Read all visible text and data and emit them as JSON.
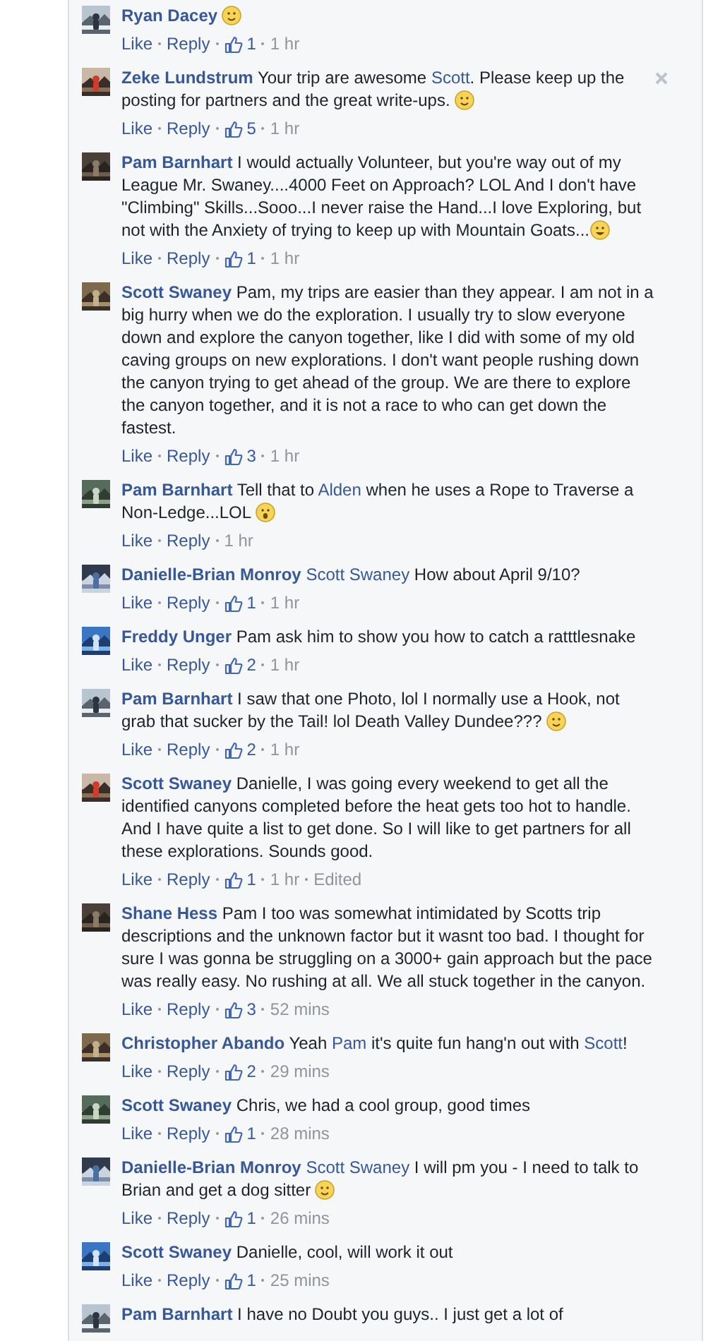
{
  "comments": [
    {
      "author": "Ryan Dacey",
      "body": [
        {
          "kind": "smile"
        }
      ],
      "actions": [
        "Like",
        "Reply"
      ],
      "likes": "1",
      "time": "1 hr",
      "show_close": false
    },
    {
      "author": "Zeke Lundstrum",
      "body": [
        {
          "kind": "text",
          "text": "Your trip are awesome "
        },
        {
          "kind": "mention",
          "text": "Scott"
        },
        {
          "kind": "text",
          "text": ". Please keep up the posting for partners and the great write-ups. "
        },
        {
          "kind": "smile"
        }
      ],
      "actions": [
        "Like",
        "Reply"
      ],
      "likes": "5",
      "time": "1 hr",
      "show_close": true
    },
    {
      "author": "Pam Barnhart",
      "body": [
        {
          "kind": "text",
          "text": "I would actually Volunteer, but you're way out of my League Mr. Swaney....4000 Feet on Approach? LOL And I don't have \"Climbing\" Skills...Sooo...I never raise the Hand...I love Exploring, but not with the Anxiety of trying to keep up with Mountain Goats..."
        },
        {
          "kind": "grin"
        }
      ],
      "actions": [
        "Like",
        "Reply"
      ],
      "likes": "1",
      "time": "1 hr",
      "show_close": false
    },
    {
      "author": "Scott Swaney",
      "body": [
        {
          "kind": "text",
          "text": "Pam, my trips are easier than they appear. I am not in a big hurry when we do the exploration. I usually try to slow everyone down and explore the canyon together, like I did with some of my old caving groups on new explorations. I don't want people rushing down the canyon trying to get ahead of the group. We are there to explore the canyon together, and it is not a race to who can get down the fastest."
        }
      ],
      "actions": [
        "Like",
        "Reply"
      ],
      "likes": "3",
      "time": "1 hr",
      "show_close": false
    },
    {
      "author": "Pam Barnhart",
      "body": [
        {
          "kind": "text",
          "text": "Tell that to "
        },
        {
          "kind": "mention",
          "text": "Alden"
        },
        {
          "kind": "text",
          "text": " when he uses a Rope to Traverse a Non-Ledge...LOL "
        },
        {
          "kind": "gasp"
        }
      ],
      "actions": [
        "Like",
        "Reply"
      ],
      "time": "1 hr",
      "show_close": false
    },
    {
      "author": "Danielle-Brian Monroy",
      "body": [
        {
          "kind": "mention",
          "text": "Scott Swaney"
        },
        {
          "kind": "text",
          "text": " How about April 9/10?"
        }
      ],
      "actions": [
        "Like",
        "Reply"
      ],
      "likes": "1",
      "time": "1 hr",
      "show_close": false
    },
    {
      "author": "Freddy Unger",
      "body": [
        {
          "kind": "text",
          "text": "Pam ask him to show you how to catch a ratttlesnake"
        }
      ],
      "actions": [
        "Like",
        "Reply"
      ],
      "likes": "2",
      "time": "1 hr",
      "show_close": false
    },
    {
      "author": "Pam Barnhart",
      "body": [
        {
          "kind": "text",
          "text": "I saw that one Photo, lol I normally use a Hook, not grab that sucker by the Tail! lol Death Valley Dundee??? "
        },
        {
          "kind": "smile"
        }
      ],
      "actions": [
        "Like",
        "Reply"
      ],
      "likes": "2",
      "time": "1 hr",
      "show_close": false
    },
    {
      "author": "Scott Swaney",
      "body": [
        {
          "kind": "text",
          "text": "Danielle, I was going every weekend to get all the identified canyons completed before the heat gets too hot to handle. And I have quite a list to get done. So I will like to get partners for all these explorations. Sounds good."
        }
      ],
      "actions": [
        "Like",
        "Reply"
      ],
      "likes": "1",
      "time": "1 hr",
      "edited": "Edited",
      "show_close": false
    },
    {
      "author": "Shane Hess",
      "body": [
        {
          "kind": "text",
          "text": "Pam I too was somewhat intimidated by Scotts trip descriptions and the unknown factor but it wasnt too bad. I thought for sure I was gonna be struggling on a 3000+ gain approach but the pace was really easy. No rushing at all. We all stuck together in the canyon."
        }
      ],
      "actions": [
        "Like",
        "Reply"
      ],
      "likes": "3",
      "time": "52 mins",
      "show_close": false
    },
    {
      "author": "Christopher Abando",
      "body": [
        {
          "kind": "text",
          "text": "Yeah "
        },
        {
          "kind": "mention",
          "text": "Pam"
        },
        {
          "kind": "text",
          "text": " it's quite fun hang'n out with "
        },
        {
          "kind": "mention",
          "text": "Scott"
        },
        {
          "kind": "text",
          "text": "!"
        }
      ],
      "actions": [
        "Like",
        "Reply"
      ],
      "likes": "2",
      "time": "29 mins",
      "show_close": false
    },
    {
      "author": "Scott Swaney",
      "body": [
        {
          "kind": "text",
          "text": "Chris, we had a cool group, good times"
        }
      ],
      "actions": [
        "Like",
        "Reply"
      ],
      "likes": "1",
      "time": "28 mins",
      "show_close": false
    },
    {
      "author": "Danielle-Brian Monroy",
      "body": [
        {
          "kind": "mention",
          "text": "Scott Swaney"
        },
        {
          "kind": "text",
          "text": " I will pm you - I need to talk to Brian and get a dog sitter "
        },
        {
          "kind": "smile"
        }
      ],
      "actions": [
        "Like",
        "Reply"
      ],
      "likes": "1",
      "time": "26 mins",
      "show_close": false
    },
    {
      "author": "Scott Swaney",
      "body": [
        {
          "kind": "text",
          "text": "Danielle, cool, will work it out"
        }
      ],
      "actions": [
        "Like",
        "Reply"
      ],
      "likes": "1",
      "time": "25 mins",
      "show_close": false
    },
    {
      "author": "Pam Barnhart",
      "body": [
        {
          "kind": "text",
          "text": "I have no Doubt you guys.. I just get a lot of"
        }
      ],
      "show_close": false
    }
  ]
}
